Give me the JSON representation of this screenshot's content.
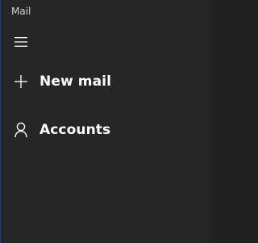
{
  "window": {
    "title": "Mail"
  },
  "menu": {
    "icon": "hamburger-icon"
  },
  "nav": {
    "new_mail": {
      "label": "New mail",
      "icon": "plus-icon"
    },
    "accounts": {
      "label": "Accounts",
      "icon": "person-icon"
    }
  },
  "colors": {
    "background": "#262626",
    "text": "#ffffff",
    "title_text": "#d2d2d2"
  }
}
